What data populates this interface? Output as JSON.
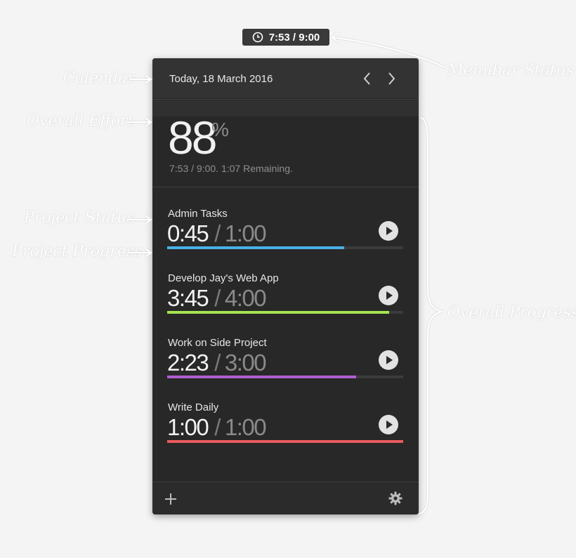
{
  "menubar": {
    "status": "7:53 / 9:00",
    "icon": "clock-icon"
  },
  "header": {
    "date": "Today, 18 March 2016",
    "prev_icon": "chevron-left-icon",
    "next_icon": "chevron-right-icon"
  },
  "effort": {
    "percent": "88",
    "percent_sign": "%",
    "summary": "7:53 / 9:00. 1:07 Remaining."
  },
  "projects": [
    {
      "name": "Admin Tasks",
      "spent": "0:45",
      "budget": "1:00",
      "progress": 0.75,
      "color": "#4ab2e8"
    },
    {
      "name": "Develop Jay's Web App",
      "spent": "3:45",
      "budget": "4:00",
      "progress": 0.94,
      "color": "#a6e34f"
    },
    {
      "name": "Work on Side Project",
      "spent": "2:23",
      "budget": "3:00",
      "progress": 0.8,
      "color": "#b15fd0"
    },
    {
      "name": "Write Daily",
      "spent": "1:00",
      "budget": "1:00",
      "progress": 1.0,
      "color": "#e85b5b"
    }
  ],
  "footer": {
    "add_icon": "plus-icon",
    "settings_icon": "gear-icon"
  },
  "annotations": {
    "calendar": "Calendar",
    "overall_effort": "Overall Effort",
    "project_status": "Project Status",
    "project_progress": "Project Progress",
    "menubar_status": "Menubar Status",
    "overall_progress": "Overall Progress"
  }
}
